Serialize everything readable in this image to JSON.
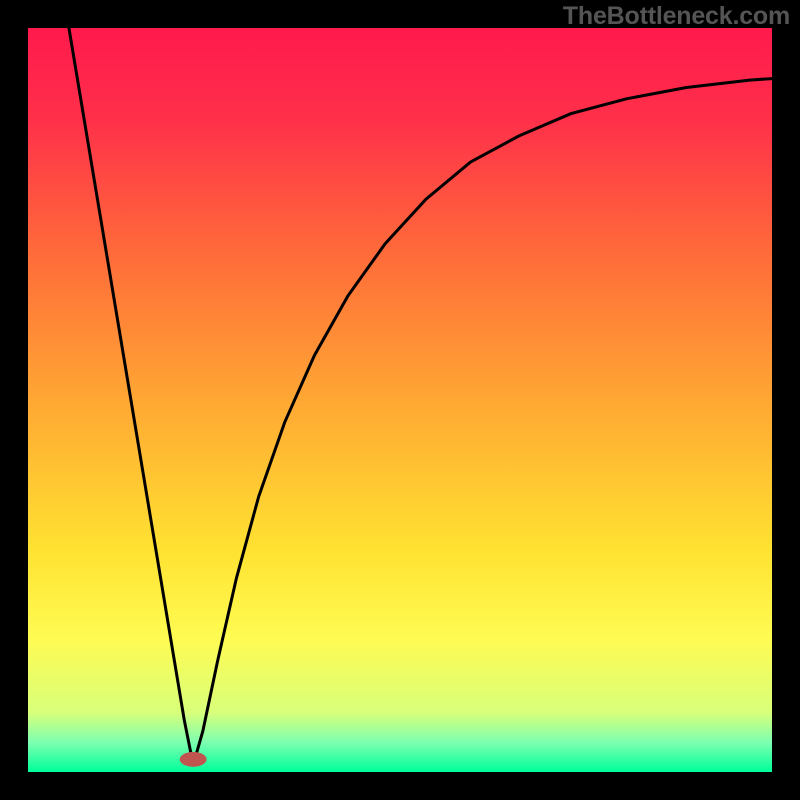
{
  "watermark": "TheBottleneck.com",
  "chart_data": {
    "type": "line",
    "title": "",
    "xlabel": "",
    "ylabel": "",
    "xlim": [
      0,
      1
    ],
    "ylim": [
      0,
      1
    ],
    "grid": false,
    "legend": false,
    "gradient_stops": [
      {
        "offset": 0.0,
        "color": "#ff1a4d"
      },
      {
        "offset": 0.12,
        "color": "#ff2f4a"
      },
      {
        "offset": 0.3,
        "color": "#ff6a3a"
      },
      {
        "offset": 0.5,
        "color": "#ffa733"
      },
      {
        "offset": 0.7,
        "color": "#ffe231"
      },
      {
        "offset": 0.82,
        "color": "#fffb52"
      },
      {
        "offset": 0.92,
        "color": "#d8ff7a"
      },
      {
        "offset": 0.96,
        "color": "#7dffb0"
      },
      {
        "offset": 1.0,
        "color": "#00ff9a"
      }
    ],
    "curve": {
      "comment": "V-shaped curve with a sharp minimum near x≈0.22; left arm is a steep straight line from top-left, right arm is a saturating concave curve rising toward top-right.",
      "points": [
        {
          "x": 0.055,
          "y": 1.0
        },
        {
          "x": 0.075,
          "y": 0.88
        },
        {
          "x": 0.095,
          "y": 0.76
        },
        {
          "x": 0.115,
          "y": 0.64
        },
        {
          "x": 0.135,
          "y": 0.52
        },
        {
          "x": 0.155,
          "y": 0.4
        },
        {
          "x": 0.175,
          "y": 0.28
        },
        {
          "x": 0.195,
          "y": 0.16
        },
        {
          "x": 0.21,
          "y": 0.07
        },
        {
          "x": 0.22,
          "y": 0.02
        },
        {
          "x": 0.225,
          "y": 0.02
        },
        {
          "x": 0.235,
          "y": 0.055
        },
        {
          "x": 0.255,
          "y": 0.15
        },
        {
          "x": 0.28,
          "y": 0.26
        },
        {
          "x": 0.31,
          "y": 0.37
        },
        {
          "x": 0.345,
          "y": 0.47
        },
        {
          "x": 0.385,
          "y": 0.56
        },
        {
          "x": 0.43,
          "y": 0.64
        },
        {
          "x": 0.48,
          "y": 0.71
        },
        {
          "x": 0.535,
          "y": 0.77
        },
        {
          "x": 0.595,
          "y": 0.82
        },
        {
          "x": 0.66,
          "y": 0.855
        },
        {
          "x": 0.73,
          "y": 0.885
        },
        {
          "x": 0.805,
          "y": 0.905
        },
        {
          "x": 0.885,
          "y": 0.92
        },
        {
          "x": 0.97,
          "y": 0.93
        },
        {
          "x": 1.0,
          "y": 0.932
        }
      ],
      "minimum_marker": {
        "x": 0.222,
        "y": 0.017,
        "rx": 0.018,
        "ry": 0.01,
        "color": "#c0554f"
      }
    }
  }
}
